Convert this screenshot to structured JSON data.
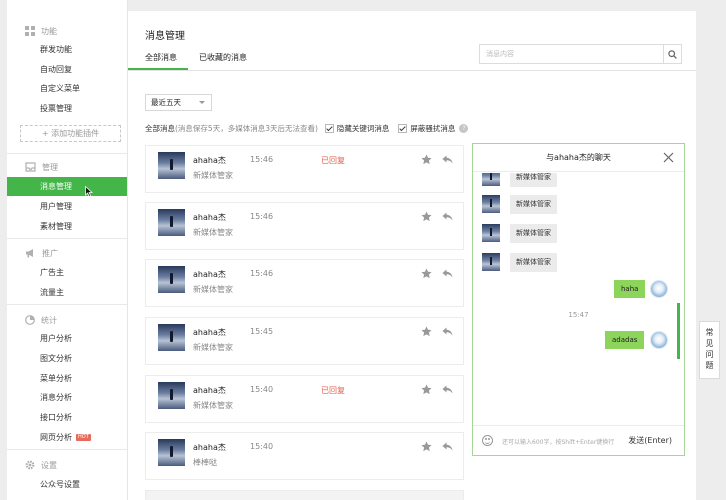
{
  "sidebar": {
    "sections": [
      {
        "title": "功能",
        "icon": "grid-icon",
        "items": [
          "群发功能",
          "自动回复",
          "自定义菜单",
          "投票管理"
        ]
      },
      {
        "title": "管理",
        "icon": "inbox-icon",
        "items": [
          "消息管理",
          "用户管理",
          "素材管理"
        ]
      },
      {
        "title": "推广",
        "icon": "megaphone-icon",
        "items": [
          "广告主",
          "流量主"
        ]
      },
      {
        "title": "统计",
        "icon": "pie-chart-icon",
        "items": [
          "用户分析",
          "图文分析",
          "菜单分析",
          "消息分析",
          "接口分析",
          "网页分析"
        ]
      },
      {
        "title": "设置",
        "icon": "gear-icon",
        "items": [
          "公众号设置"
        ]
      }
    ],
    "add_plugin": "+ 添加功能插件",
    "hot_badge": "HOT",
    "active_item": "消息管理"
  },
  "header": {
    "title": "消息管理",
    "tabs": [
      "全部消息",
      "已收藏的消息"
    ],
    "active_tab": "全部消息",
    "search_placeholder": "消息内容"
  },
  "filters": {
    "range": "最近五天",
    "label": "全部消息",
    "note": "(消息保存5天，多媒体消息3天后无法查看)",
    "hide_keyword": "隐藏关键词消息",
    "block_spam": "屏蔽骚扰消息",
    "hide_keyword_checked": true,
    "block_spam_checked": true
  },
  "messages": [
    {
      "name": "ahaha杰",
      "time": "15:46",
      "status": "已回复",
      "text": "新媒体管家"
    },
    {
      "name": "ahaha杰",
      "time": "15:46",
      "status": "",
      "text": "新媒体管家"
    },
    {
      "name": "ahaha杰",
      "time": "15:46",
      "status": "",
      "text": "新媒体管家"
    },
    {
      "name": "ahaha杰",
      "time": "15:45",
      "status": "",
      "text": "新媒体管家"
    },
    {
      "name": "ahaha杰",
      "time": "15:40",
      "status": "已回复",
      "text": "新媒体管家"
    },
    {
      "name": "ahaha杰",
      "time": "15:40",
      "status": "",
      "text": "棒棒哒"
    }
  ],
  "chat": {
    "title": "与ahaha杰的聊天",
    "incoming": [
      "新媒体管家",
      "新媒体管家",
      "新媒体管家",
      "新媒体管家"
    ],
    "outgoing": [
      "haha",
      "adadas"
    ],
    "time_divider": "15:47",
    "input_hint": "还可以输入600字，按Shift+Enter键换行",
    "send_label": "发送(Enter)"
  },
  "faq": {
    "label": [
      "常",
      "见",
      "问",
      "题"
    ]
  },
  "colors": {
    "accent": "#44b549",
    "status_red": "#e15f4a",
    "bubble_out": "#8cd45a"
  }
}
